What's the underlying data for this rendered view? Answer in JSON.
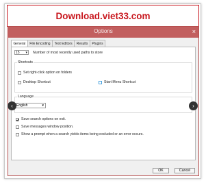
{
  "banner": {
    "text": "Download.viet33.com"
  },
  "window": {
    "title": "Options",
    "close_glyph": "×"
  },
  "tabs": [
    {
      "label": "General",
      "active": true
    },
    {
      "label": "File Encoding",
      "active": false
    },
    {
      "label": "Text Editors",
      "active": false
    },
    {
      "label": "Results",
      "active": false
    },
    {
      "label": "Plugins",
      "active": false
    }
  ],
  "recent_paths": {
    "value": "15",
    "label": "Number of most recently used paths to store"
  },
  "shortcuts": {
    "group_label": "Shortcuts",
    "right_click": {
      "label": "Set right-click option on folders",
      "checked": false
    },
    "desktop": {
      "label": "Desktop Shortcut",
      "checked": false
    },
    "start_menu": {
      "label": "Start Menu Shortcut",
      "checked": false
    }
  },
  "language": {
    "label": "Language",
    "selected": "English"
  },
  "options": {
    "save_search": {
      "label": "Save search options on exit.",
      "checked": true
    },
    "save_messages": {
      "label": "Save messages window position.",
      "checked": false
    },
    "show_prompt": {
      "label": "Show a prompt when a search yields items being excluded or an error occurs.",
      "checked": false
    }
  },
  "buttons": {
    "ok": "OK",
    "cancel": "Cancel"
  },
  "nav": {
    "prev_glyph": "‹",
    "next_glyph": "›"
  },
  "colors": {
    "title_bar": "#c25f5f",
    "banner_text": "#c8161d",
    "nav_button": "#333333"
  }
}
